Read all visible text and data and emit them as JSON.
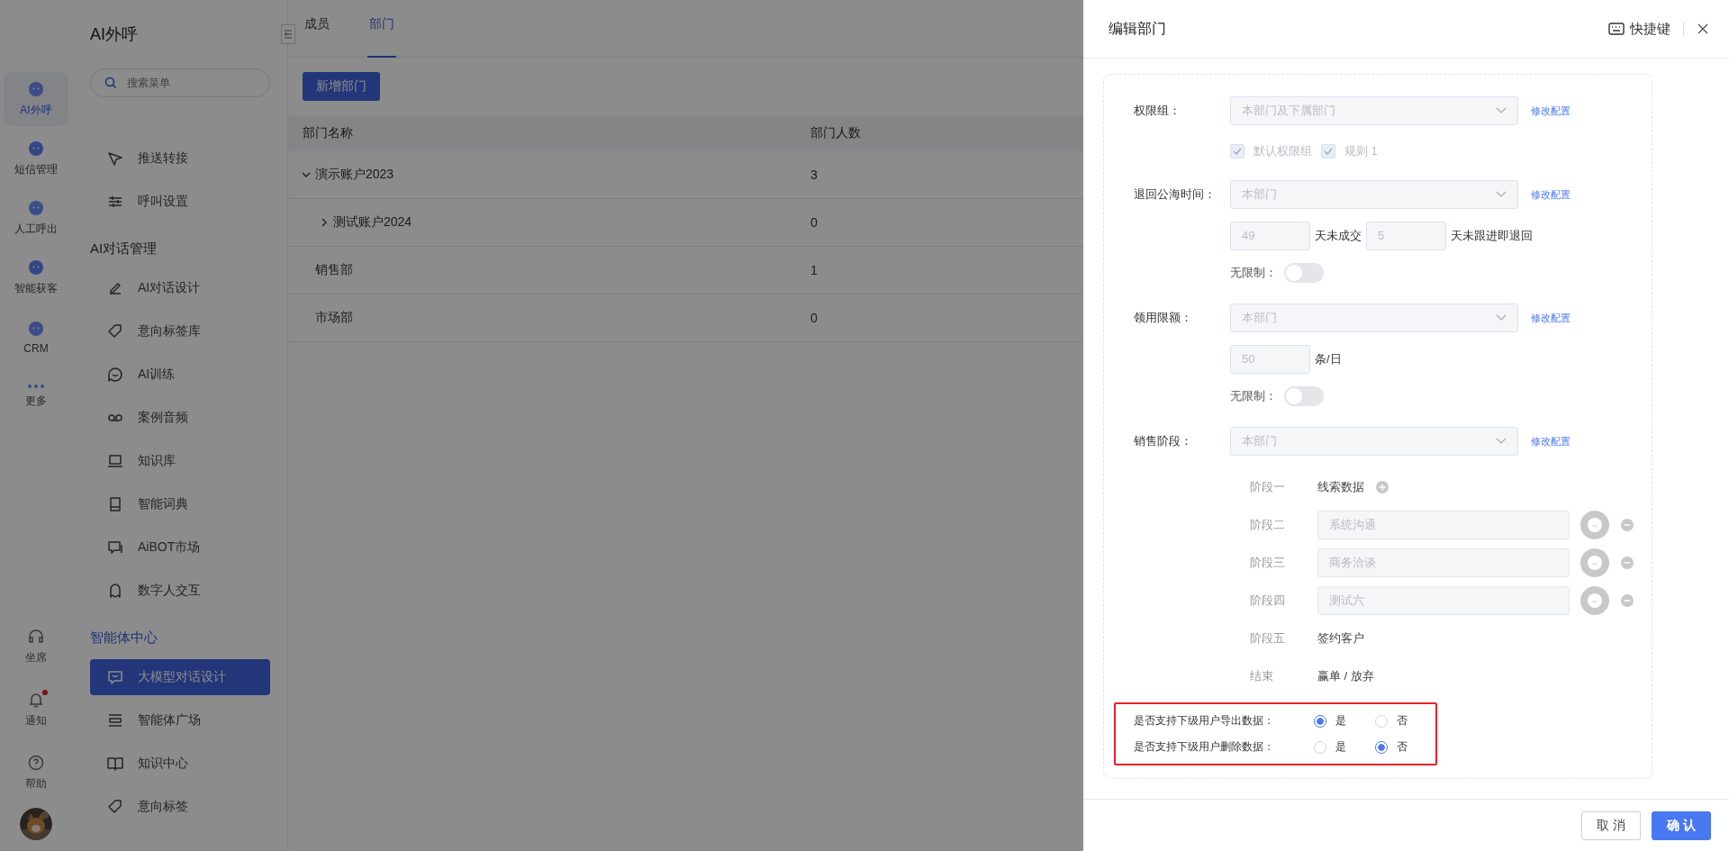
{
  "rail": {
    "items": [
      {
        "label": "AI外呼",
        "selected": true
      },
      {
        "label": "短信管理",
        "selected": false
      },
      {
        "label": "人工呼出",
        "selected": false
      },
      {
        "label": "智能获客",
        "selected": false
      },
      {
        "label": "CRM",
        "selected": false
      },
      {
        "label": "更多",
        "selected": false
      }
    ],
    "bottom_items": [
      {
        "label": "坐席",
        "badge": false
      },
      {
        "label": "通知",
        "badge": true
      },
      {
        "label": "帮助",
        "badge": false
      }
    ]
  },
  "menu": {
    "title": "AI外呼",
    "search": {
      "placeholder": "搜索菜单"
    },
    "sections": [
      {
        "items": [
          {
            "label": "推送转接",
            "selected": false
          },
          {
            "label": "呼叫设置",
            "selected": false
          }
        ]
      },
      {
        "heading": "AI对话管理",
        "items": [
          {
            "label": "AI对话设计",
            "selected": false
          },
          {
            "label": "意向标签库",
            "selected": false
          },
          {
            "label": "AI训练",
            "selected": false
          },
          {
            "label": "案例音频",
            "selected": false
          },
          {
            "label": "知识库",
            "selected": false
          },
          {
            "label": "智能词典",
            "selected": false
          },
          {
            "label": "AiBOT市场",
            "selected": false
          },
          {
            "label": "数字人交互",
            "selected": false
          }
        ]
      },
      {
        "heading": "智能体中心",
        "items": [
          {
            "label": "大模型对话设计",
            "selected": true
          },
          {
            "label": "智能体广场",
            "selected": false
          },
          {
            "label": "知识中心",
            "selected": false
          },
          {
            "label": "意向标签",
            "selected": false
          }
        ]
      }
    ]
  },
  "main": {
    "tabs": [
      {
        "label": "成员",
        "selected": false
      },
      {
        "label": "部门",
        "selected": true
      }
    ],
    "add_button": "新增部门",
    "table": {
      "columns": [
        "部门名称",
        "部门人数"
      ],
      "rows": [
        {
          "name": "演示账户2023",
          "count": "3",
          "expanded": true,
          "children": [
            {
              "name": "测试账户2024",
              "count": "0",
              "expanded": false
            }
          ]
        },
        {
          "name": "销售部",
          "count": "1"
        },
        {
          "name": "市场部",
          "count": "0"
        }
      ]
    }
  },
  "drawer": {
    "title": "编辑部门",
    "shortcut": "快捷键",
    "form": [
      {
        "kind": "select",
        "label": "权限组：",
        "value": "本部门及下属部门",
        "link": "修改配置"
      },
      {
        "kind": "checkboxes",
        "options": [
          {
            "label": "默认权限组",
            "checked": true
          },
          {
            "label": "规则 1",
            "checked": true
          }
        ]
      },
      {
        "kind": "select",
        "label": "退回公海时间：",
        "value": "本部门",
        "link": "修改配置"
      },
      {
        "kind": "inputs",
        "parts": [
          {
            "kind": "input",
            "value": "49"
          },
          {
            "kind": "text",
            "text": "天未成交"
          },
          {
            "kind": "input",
            "value": "5"
          },
          {
            "kind": "text",
            "text": "天未跟进即退回"
          }
        ]
      },
      {
        "kind": "switch",
        "label": "无限制：",
        "on": false
      },
      {
        "kind": "select",
        "label": "领用限额：",
        "value": "本部门",
        "link": "修改配置"
      },
      {
        "kind": "inputs",
        "parts": [
          {
            "kind": "input",
            "value": "50"
          },
          {
            "kind": "text",
            "text": "条/日"
          }
        ]
      },
      {
        "kind": "switch",
        "label": "无限制：",
        "on": false
      },
      {
        "kind": "select",
        "label": "销售阶段：",
        "value": "本部门",
        "link": "修改配置"
      },
      {
        "kind": "stages",
        "stages": [
          {
            "kind": "fixed",
            "name": "阶段一",
            "value": "线索数据",
            "addable": true
          },
          {
            "kind": "input",
            "name": "阶段二",
            "value": "系统沟通"
          },
          {
            "kind": "input",
            "name": "阶段三",
            "value": "商务洽谈"
          },
          {
            "kind": "input",
            "name": "阶段四",
            "value": "测试六"
          },
          {
            "kind": "fixed",
            "name": "阶段五",
            "value": "签约客户"
          },
          {
            "kind": "fixed",
            "name": "结束",
            "value": "赢单 / 放弃"
          }
        ]
      },
      {
        "kind": "radios",
        "highlighted": true,
        "questions": [
          {
            "label": "是否支持下级用户导出数据：",
            "options": [
              {
                "label": "是",
                "selected": true
              },
              {
                "label": "否",
                "selected": false
              }
            ]
          },
          {
            "label": "是否支持下级用户删除数据：",
            "options": [
              {
                "label": "是",
                "selected": false
              },
              {
                "label": "否",
                "selected": true
              }
            ]
          }
        ]
      }
    ],
    "buttons": [
      {
        "kind": "cancel",
        "label": "取 消"
      },
      {
        "kind": "confirm",
        "label": "确 认"
      }
    ]
  }
}
